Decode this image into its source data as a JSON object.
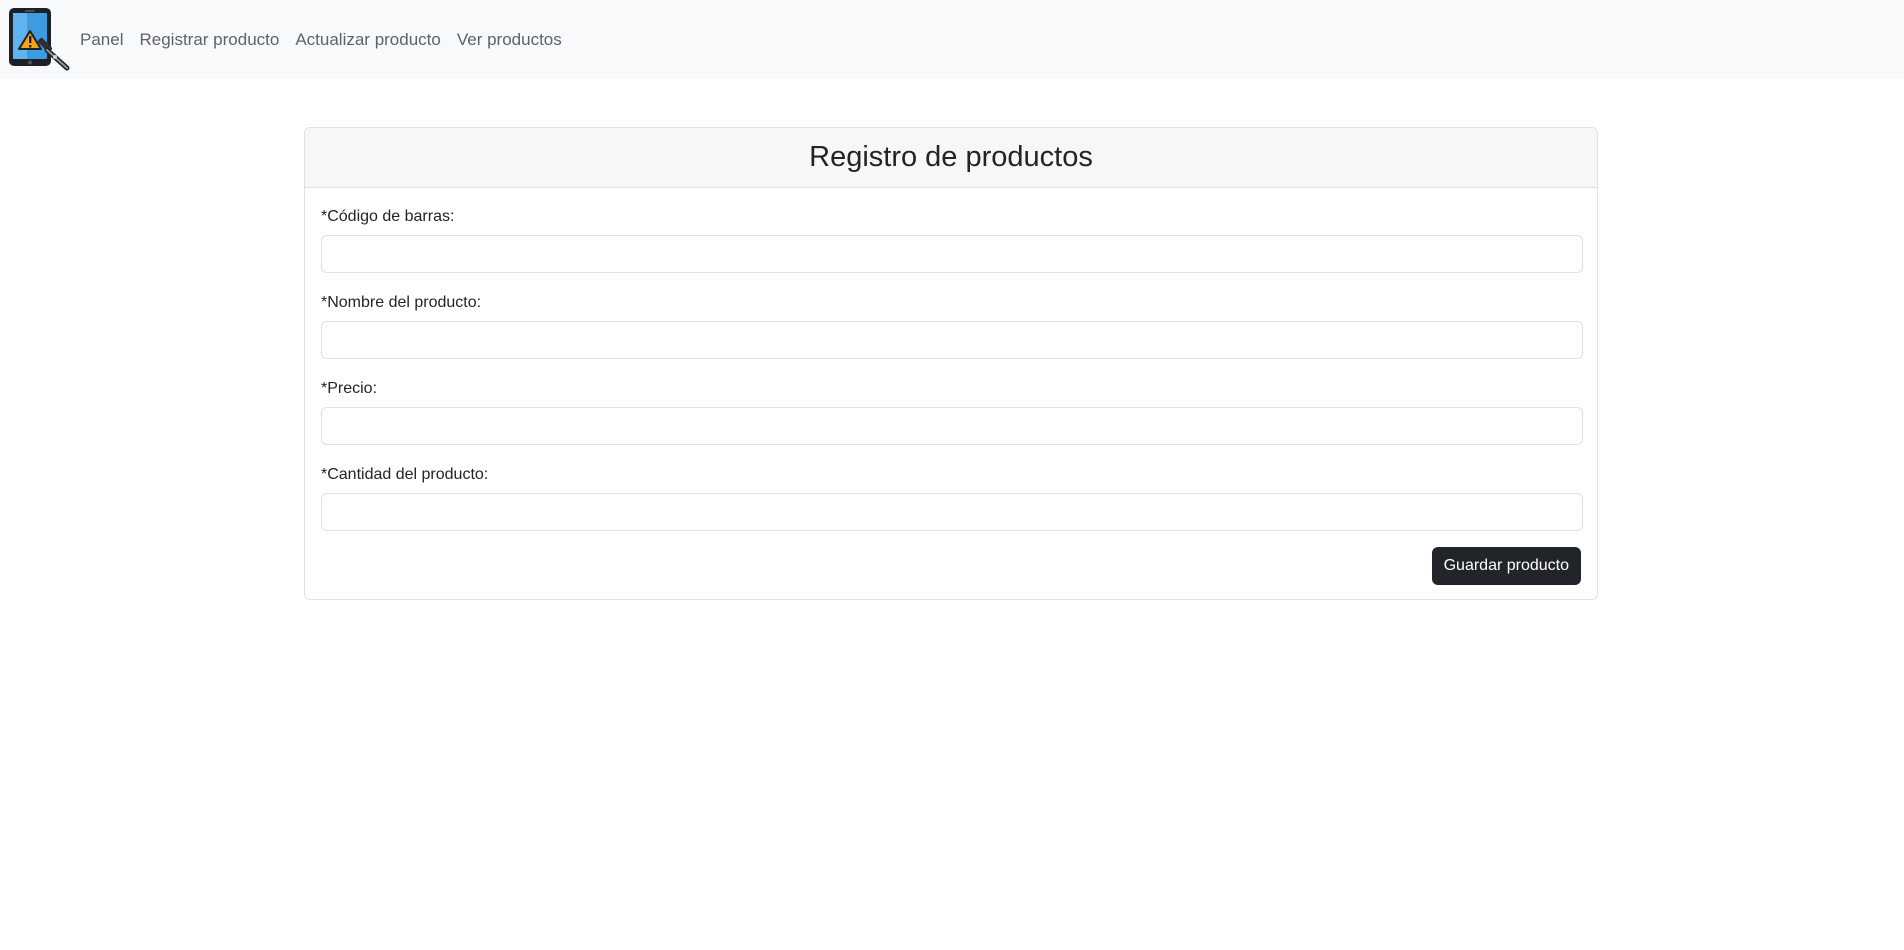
{
  "navbar": {
    "logo_icon": "phone-repair-warning-icon",
    "links": [
      {
        "label": "Panel"
      },
      {
        "label": "Registrar producto"
      },
      {
        "label": "Actualizar producto"
      },
      {
        "label": "Ver productos"
      }
    ]
  },
  "form": {
    "title": "Registro de productos",
    "fields": [
      {
        "label": "*Código de barras:",
        "value": "",
        "placeholder": ""
      },
      {
        "label": "*Nombre del producto:",
        "value": "",
        "placeholder": ""
      },
      {
        "label": "*Precio:",
        "value": "",
        "placeholder": ""
      },
      {
        "label": "*Cantidad del producto:",
        "value": "",
        "placeholder": ""
      }
    ],
    "submit_label": "Guardar producto"
  },
  "colors": {
    "navbar_bg": "#f8f9fa",
    "button_bg": "#212529",
    "card_header_bg": "#f7f7f7",
    "logo_screen": "#3d9be0",
    "warning": "#f5a31a"
  }
}
